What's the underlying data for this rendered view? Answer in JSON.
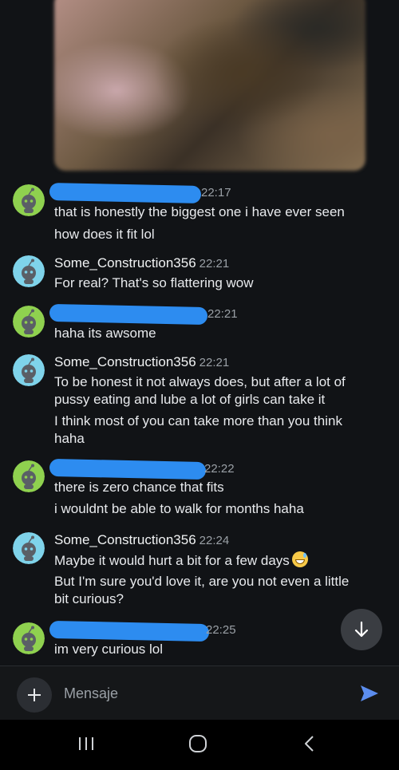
{
  "messages": [
    {
      "sender": "",
      "redacted": true,
      "time": "22:17",
      "avatar": "green",
      "lines": [
        "that is honestly the biggest one i have ever seen",
        "how does it fit lol"
      ]
    },
    {
      "sender": "Some_Construction356",
      "redacted": false,
      "time": "22:21",
      "avatar": "blue",
      "lines": [
        "For real? That's so flattering wow"
      ]
    },
    {
      "sender": "",
      "redacted": true,
      "time": "22:21",
      "avatar": "green",
      "lines": [
        "haha its awsome"
      ]
    },
    {
      "sender": "Some_Construction356",
      "redacted": false,
      "time": "22:21",
      "avatar": "blue",
      "lines": [
        "To be honest it not always does, but after a lot of",
        "pussy eating and lube a lot of girls can take it",
        "I think most of you can take more than you think",
        "haha"
      ]
    },
    {
      "sender": "",
      "redacted": true,
      "time": "22:22",
      "avatar": "green",
      "lines": [
        "there is zero chance that fits",
        "i wouldnt be able to walk for months haha"
      ]
    },
    {
      "sender": "Some_Construction356",
      "redacted": false,
      "time": "22:24",
      "avatar": "blue",
      "lines": [
        "Maybe it would hurt a bit for a few days",
        "But I'm sure you'd love it, are you not even a little",
        "bit curious?"
      ]
    },
    {
      "sender": "",
      "redacted": true,
      "time": "22:25",
      "avatar": "green",
      "lines": [
        "im very curious lol"
      ]
    }
  ],
  "emoji": "grinning-sweat-emoji",
  "composer": {
    "placeholder": "Mensaje"
  },
  "colors": {
    "green_avatar": "#8fd14f",
    "blue_avatar": "#7fd3ea",
    "redaction": "#2d8cf0",
    "send": "#5b8dee"
  },
  "icons": [
    "scroll-down-arrow-icon",
    "plus-icon",
    "send-icon",
    "recent-apps-icon",
    "home-icon",
    "back-icon"
  ]
}
